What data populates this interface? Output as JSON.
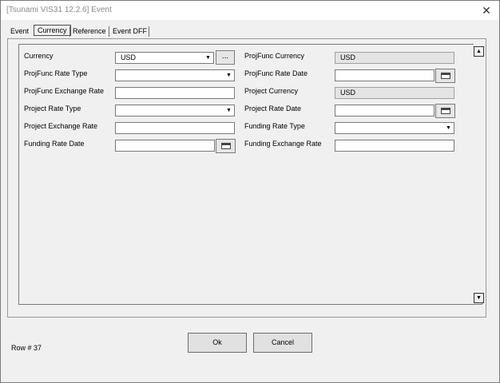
{
  "window": {
    "title": "[Tsunami VIS31 12.2.6] Event",
    "close_glyph": "✕"
  },
  "tabs": [
    {
      "label": "Event",
      "active": false
    },
    {
      "label": "Currency",
      "active": true
    },
    {
      "label": "Reference",
      "active": false
    },
    {
      "label": "Event DFF",
      "active": false
    }
  ],
  "form": {
    "currency": {
      "label": "Currency",
      "value": "USD",
      "lov_label": "..."
    },
    "projfunc_rate_type": {
      "label": "ProjFunc Rate Type",
      "value": ""
    },
    "projfunc_exchange_rate": {
      "label": "ProjFunc Exchange Rate",
      "value": ""
    },
    "project_rate_type": {
      "label": "Project Rate Type",
      "value": ""
    },
    "project_exchange_rate": {
      "label": "Project Exchange Rate",
      "value": ""
    },
    "funding_rate_date": {
      "label": "Funding Rate Date",
      "value": ""
    },
    "projfunc_currency": {
      "label": "ProjFunc Currency",
      "value": "USD"
    },
    "projfunc_rate_date": {
      "label": "ProjFunc Rate Date",
      "value": ""
    },
    "project_currency": {
      "label": "Project Currency",
      "value": "USD"
    },
    "project_rate_date": {
      "label": "Project Rate Date",
      "value": ""
    },
    "funding_rate_type": {
      "label": "Funding Rate Type",
      "value": ""
    },
    "funding_exchange_rate": {
      "label": "Funding Exchange Rate",
      "value": ""
    }
  },
  "icons": {
    "dropdown": "▼",
    "scroll_up": "▲",
    "scroll_down": "▼"
  },
  "status": {
    "row": "Row # 37"
  },
  "buttons": {
    "ok": "Ok",
    "cancel": "Cancel"
  }
}
